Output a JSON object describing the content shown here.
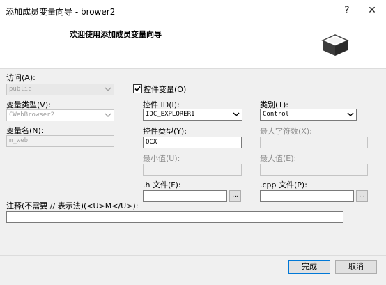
{
  "window": {
    "title": "添加成员变量向导 - brower2",
    "help_glyph": "?",
    "close_glyph": "✕"
  },
  "banner": {
    "title": "欢迎使用添加成员变量向导"
  },
  "access": {
    "label": "访问(A):",
    "value": "public"
  },
  "control_var": {
    "label": "控件变量(O)",
    "checked": true
  },
  "var_type": {
    "label": "变量类型(V):",
    "value": "CWebBrowser2"
  },
  "control_id": {
    "label": "控件 ID(I):",
    "value": "IDC_EXPLORER1"
  },
  "category": {
    "label": "类别(T):",
    "value": "Control"
  },
  "var_name": {
    "label": "变量名(N):",
    "value": "m_web"
  },
  "control_type": {
    "label": "控件类型(Y):",
    "value": "OCX"
  },
  "max_chars": {
    "label": "最大字符数(X):",
    "value": ""
  },
  "min_value": {
    "label": "最小值(U):",
    "value": ""
  },
  "max_value": {
    "label": "最大值(E):",
    "value": ""
  },
  "h_file": {
    "label": ".h 文件(F):",
    "value": "",
    "browse_label": "..."
  },
  "cpp_file": {
    "label": ".cpp 文件(P):",
    "value": "",
    "browse_label": "..."
  },
  "comment": {
    "label": "注释(不需要 // 表示法)(<U>M</U>):",
    "value": ""
  },
  "buttons": {
    "finish": "完成",
    "cancel": "取消"
  },
  "colors": {
    "accent": "#0078d7",
    "dialog_bg": "#f0f0f0"
  }
}
